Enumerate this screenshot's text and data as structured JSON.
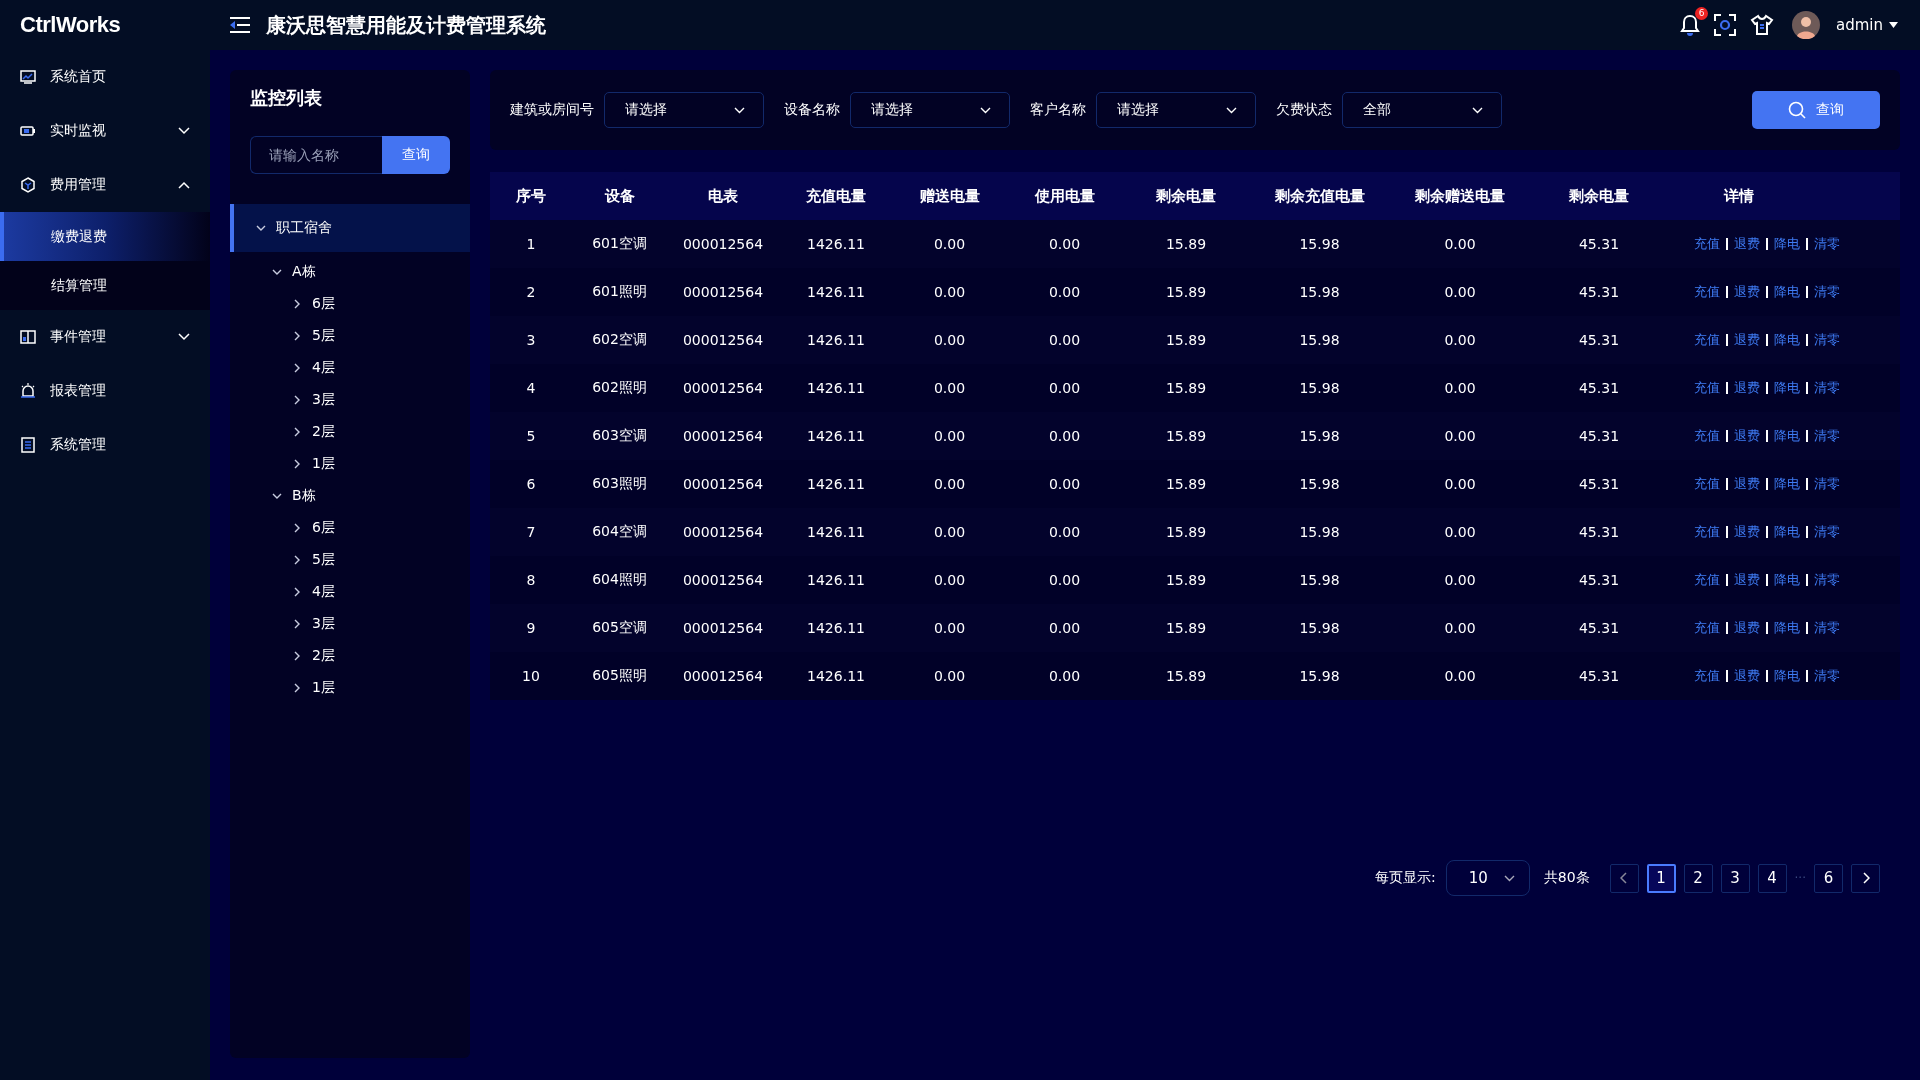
{
  "header": {
    "logo": "CtrlWorks",
    "title": "康沃思智慧用能及计费管理系统",
    "notification_count": "6",
    "user": "admin"
  },
  "sidebar": {
    "items": [
      {
        "label": "系统首页",
        "selected": false
      },
      {
        "label": "实时监视",
        "selected": false,
        "expanded": false
      },
      {
        "label": "费用管理",
        "selected": false,
        "expanded": true,
        "children": [
          {
            "label": "缴费退费",
            "selected": true
          },
          {
            "label": "结算管理",
            "selected": false
          }
        ]
      },
      {
        "label": "事件管理",
        "selected": false,
        "expanded": false
      },
      {
        "label": "报表管理",
        "selected": false
      },
      {
        "label": "系统管理",
        "selected": false
      }
    ]
  },
  "tree_panel": {
    "title": "监控列表",
    "search": {
      "placeholder": "请输入名称"
    },
    "search_button": "查询",
    "tree": [
      {
        "label": "职工宿舍",
        "expanded": true,
        "selected": true,
        "children": [
          {
            "label": "A栋",
            "expanded": true,
            "selected": false,
            "children": [
              {
                "label": "6层",
                "expanded": false,
                "selected": false
              },
              {
                "label": "5层",
                "expanded": false,
                "selected": false
              },
              {
                "label": "4层",
                "expanded": false,
                "selected": false
              },
              {
                "label": "3层",
                "expanded": false,
                "selected": false
              },
              {
                "label": "2层",
                "expanded": false,
                "selected": false
              },
              {
                "label": "1层",
                "expanded": false,
                "selected": false
              }
            ]
          },
          {
            "label": "B栋",
            "expanded": true,
            "selected": false,
            "children": [
              {
                "label": "6层",
                "expanded": false,
                "selected": false
              },
              {
                "label": "5层",
                "expanded": false,
                "selected": false
              },
              {
                "label": "4层",
                "expanded": false,
                "selected": false
              },
              {
                "label": "3层",
                "expanded": false,
                "selected": false
              },
              {
                "label": "2层",
                "expanded": false,
                "selected": false
              },
              {
                "label": "1层",
                "expanded": false,
                "selected": false
              }
            ]
          }
        ]
      }
    ]
  },
  "filters": [
    {
      "label": "建筑或房间号",
      "value": "请选择"
    },
    {
      "label": "设备名称",
      "value": "请选择"
    },
    {
      "label": "客户名称",
      "value": "请选择"
    },
    {
      "label": "欠费状态",
      "value": "全部"
    }
  ],
  "query_button": "查询",
  "table": {
    "columns": [
      "序号",
      "设备",
      "电表",
      "充值电量",
      "赠送电量",
      "使用电量",
      "剩余电量",
      "剩余充值电量",
      "剩余赠送电量",
      "剩余电量",
      "详情"
    ],
    "rows": [
      {
        "cells": [
          "1",
          "601空调",
          "000012564",
          "1426.11",
          "0.00",
          "0.00",
          "15.89",
          "15.98",
          "0.00",
          "45.31"
        ],
        "actions": [
          "充值",
          "退费",
          "降电",
          "清零"
        ]
      },
      {
        "cells": [
          "2",
          "601照明",
          "000012564",
          "1426.11",
          "0.00",
          "0.00",
          "15.89",
          "15.98",
          "0.00",
          "45.31"
        ],
        "actions": [
          "充值",
          "退费",
          "降电",
          "清零"
        ]
      },
      {
        "cells": [
          "3",
          "602空调",
          "000012564",
          "1426.11",
          "0.00",
          "0.00",
          "15.89",
          "15.98",
          "0.00",
          "45.31"
        ],
        "actions": [
          "充值",
          "退费",
          "降电",
          "清零"
        ]
      },
      {
        "cells": [
          "4",
          "602照明",
          "000012564",
          "1426.11",
          "0.00",
          "0.00",
          "15.89",
          "15.98",
          "0.00",
          "45.31"
        ],
        "actions": [
          "充值",
          "退费",
          "降电",
          "清零"
        ]
      },
      {
        "cells": [
          "5",
          "603空调",
          "000012564",
          "1426.11",
          "0.00",
          "0.00",
          "15.89",
          "15.98",
          "0.00",
          "45.31"
        ],
        "actions": [
          "充值",
          "退费",
          "降电",
          "清零"
        ]
      },
      {
        "cells": [
          "6",
          "603照明",
          "000012564",
          "1426.11",
          "0.00",
          "0.00",
          "15.89",
          "15.98",
          "0.00",
          "45.31"
        ],
        "actions": [
          "充值",
          "退费",
          "降电",
          "清零"
        ]
      },
      {
        "cells": [
          "7",
          "604空调",
          "000012564",
          "1426.11",
          "0.00",
          "0.00",
          "15.89",
          "15.98",
          "0.00",
          "45.31"
        ],
        "actions": [
          "充值",
          "退费",
          "降电",
          "清零"
        ]
      },
      {
        "cells": [
          "8",
          "604照明",
          "000012564",
          "1426.11",
          "0.00",
          "0.00",
          "15.89",
          "15.98",
          "0.00",
          "45.31"
        ],
        "actions": [
          "充值",
          "退费",
          "降电",
          "清零"
        ]
      },
      {
        "cells": [
          "9",
          "605空调",
          "000012564",
          "1426.11",
          "0.00",
          "0.00",
          "15.89",
          "15.98",
          "0.00",
          "45.31"
        ],
        "actions": [
          "充值",
          "退费",
          "降电",
          "清零"
        ]
      },
      {
        "cells": [
          "10",
          "605照明",
          "000012564",
          "1426.11",
          "0.00",
          "0.00",
          "15.89",
          "15.98",
          "0.00",
          "45.31"
        ],
        "actions": [
          "充值",
          "退费",
          "降电",
          "清零"
        ]
      }
    ]
  },
  "pagination": {
    "page_size_label": "每页显示:",
    "page_size": "10",
    "total": "共80条",
    "pages": [
      {
        "label": "1",
        "selected": true
      },
      {
        "label": "2",
        "selected": false
      },
      {
        "label": "3",
        "selected": false
      },
      {
        "label": "4",
        "selected": false
      },
      {
        "label": "···",
        "kind": "ellipsis"
      },
      {
        "label": "6",
        "selected": false
      }
    ]
  }
}
